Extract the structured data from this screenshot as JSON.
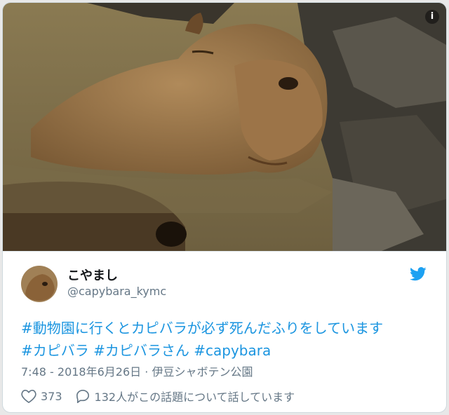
{
  "photo": {
    "info_icon_glyph": "i"
  },
  "author": {
    "name": "こやまし",
    "handle": "@capybara_kymc"
  },
  "tweet": {
    "hashtag1": "#動物園に行くとカピバラが必ず死んだふりをしています",
    "hashtag2": "#カピバラ",
    "hashtag3": "#カピバラさん",
    "hashtag4": "#capybara"
  },
  "meta": {
    "time": "7:48",
    "date": "2018年6月26日",
    "separator": "·",
    "location": "伊豆シャボテン公園"
  },
  "actions": {
    "likes": "373",
    "replies_text": "132人がこの話題について話しています"
  },
  "colors": {
    "link": "#1b95e0",
    "twitter_blue": "#1da1f2",
    "muted": "#657786"
  },
  "icons": {
    "info": "info-icon",
    "bird": "twitter-bird-icon",
    "heart": "heart-icon",
    "reply": "reply-bubble-icon"
  }
}
